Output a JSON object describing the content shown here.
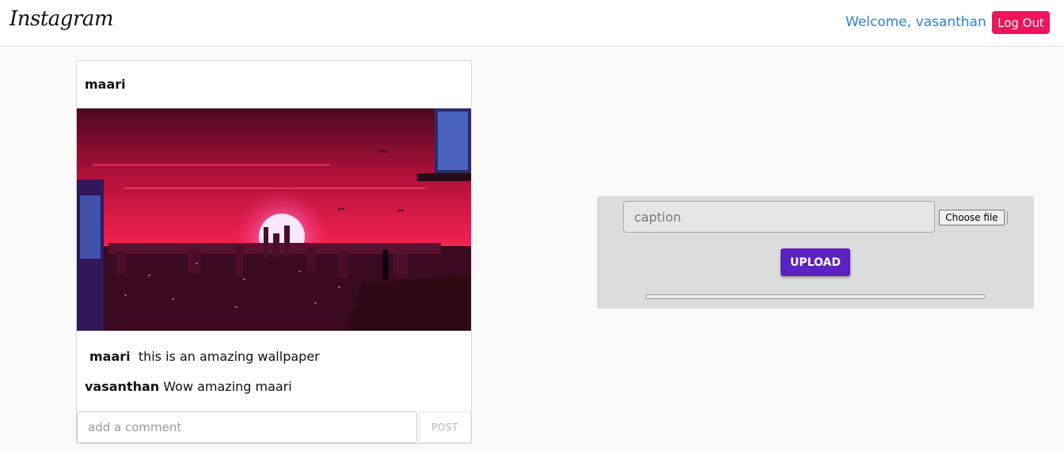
{
  "header": {
    "logo": "Instagram",
    "welcome": "Welcome, vasanthan",
    "logout_label": "Log Out"
  },
  "post": {
    "username": "maari",
    "image_description": "",
    "caption_user": "maari",
    "caption_text": "this is an amazing wallpaper",
    "comments": [
      {
        "user": "vasanthan",
        "text": "Wow amazing maari"
      }
    ],
    "comment_placeholder": "add a comment",
    "post_label": "POST"
  },
  "upload": {
    "caption_placeholder": "caption",
    "file_button_label": "Choose file",
    "upload_label": "UPLOAD",
    "progress": 0
  },
  "colors": {
    "accent": "#5b21c2",
    "logout": "#f0145a",
    "welcome": "#2f80d8"
  }
}
